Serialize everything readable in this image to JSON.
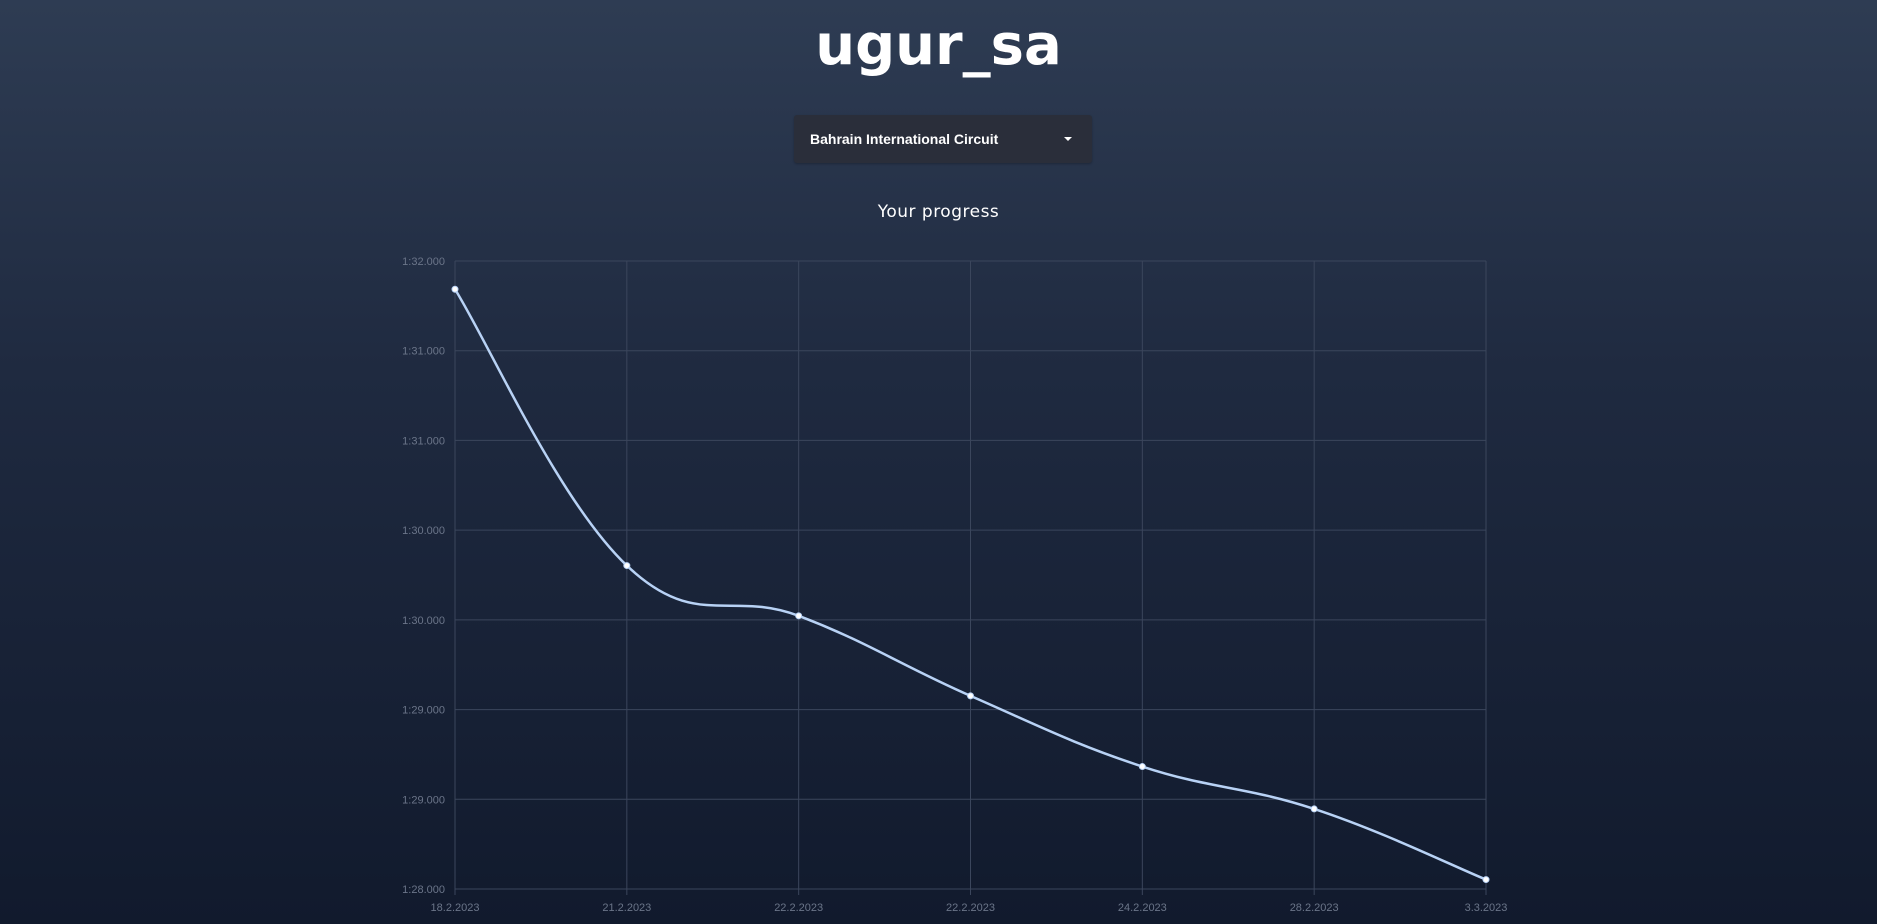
{
  "header": {
    "username": "ugur_sa"
  },
  "track_select": {
    "selected": "Bahrain International Circuit",
    "icon": "caret-down-icon"
  },
  "chart_data": {
    "type": "line",
    "title": "Your progress",
    "x": [
      "18.2.2023",
      "21.2.2023",
      "22.2.2023",
      "22.2.2023",
      "24.2.2023",
      "28.2.2023",
      "3.3.2023"
    ],
    "series": [
      {
        "values_seconds": [
          91.82,
          90.06,
          89.74,
          89.23,
          88.78,
          88.51,
          88.06
        ],
        "color": "#b8d2f5"
      }
    ],
    "y_tick_labels": [
      "1:32.000",
      "1:31.000",
      "1:31.000",
      "1:30.000",
      "1:30.000",
      "1:29.000",
      "1:29.000",
      "1:28.000"
    ],
    "ylim_seconds": [
      88.0,
      92.0
    ],
    "grid": true,
    "legend": "none"
  },
  "colors": {
    "line": "#b8d2f5",
    "grid": "#3b465c",
    "tick_text": "#6b7589",
    "dropdown_bg": "#2a2e3a"
  }
}
